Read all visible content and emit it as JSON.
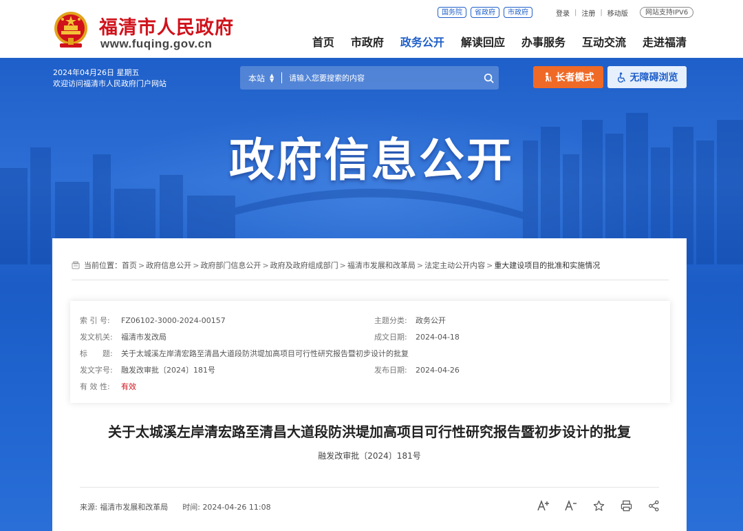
{
  "header": {
    "site_name": "福清市人民政府",
    "domain": "www.fuqing.gov.cn",
    "gov_links": [
      "国务院",
      "省政府",
      "市政府"
    ],
    "user_links": [
      "登录",
      "注册",
      "移动版"
    ],
    "ipv6": "网站支持IPV6",
    "nav": [
      "首页",
      "市政府",
      "政务公开",
      "解读回应",
      "办事服务",
      "互动交流",
      "走进福清"
    ],
    "active_nav": "政务公开"
  },
  "banner": {
    "date": "2024年04月26日 星期五",
    "welcome": "欢迎访问福清市人民政府门户网站",
    "search": {
      "scope": "本站",
      "placeholder": "请输入您要搜索的内容"
    },
    "elder_mode": "长者模式",
    "accessible": "无障碍浏览",
    "title": "政府信息公开"
  },
  "breadcrumb": {
    "label": "当前位置：",
    "items": [
      "首页",
      "政府信息公开",
      "政府部门信息公开",
      "政府及政府组成部门",
      "福清市发展和改革局",
      "法定主动公开内容",
      "重大建设项目的批准和实施情况"
    ]
  },
  "info": {
    "index_label": "索 引 号:",
    "index_value": "FZ06102-3000-2024-00157",
    "category_label": "主题分类:",
    "category_value": "政务公开",
    "issuer_label": "发文机关:",
    "issuer_value": "福清市发改局",
    "created_label": "成文日期:",
    "created_value": "2024-04-18",
    "title_label": "标　　题:",
    "title_value": "关于太城溪左岸清宏路至清昌大道段防洪堤加高项目可行性研究报告暨初步设计的批复",
    "docno_label": "发文字号:",
    "docno_value": "融发改审批〔2024〕181号",
    "published_label": "发布日期:",
    "published_value": "2024-04-26",
    "validity_label": "有 效 性:",
    "validity_value": "有效"
  },
  "document": {
    "title": "关于太城溪左岸清宏路至清昌大道段防洪堤加高项目可行性研究报告暨初步设计的批复",
    "number": "融发改审批〔2024〕181号",
    "source_label": "来源:",
    "source_value": "福清市发展和改革局",
    "time_label": "时间:",
    "time_value": "2024-04-26 11:08"
  },
  "colors": {
    "brand_red": "#d0121b",
    "brand_blue": "#1f5fc9",
    "elder_orange": "#ef6a27"
  },
  "icons": [
    "national-emblem-icon",
    "search-icon",
    "elder-mode-icon",
    "wheelchair-icon",
    "font-increase-icon",
    "font-decrease-icon",
    "favorite-star-icon",
    "print-icon",
    "share-icon",
    "location-icon"
  ]
}
